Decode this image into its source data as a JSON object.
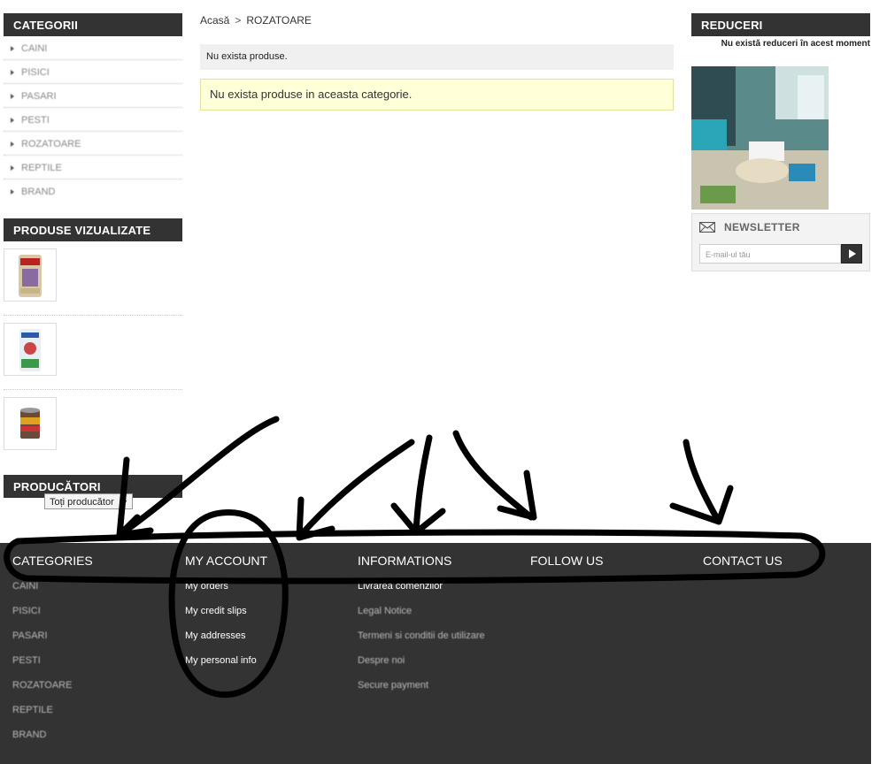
{
  "left": {
    "categories_title": "CATEGORII",
    "categories": [
      "CAINI",
      "PISICI",
      "PASARI",
      "PESTI",
      "ROZATOARE",
      "REPTILE",
      "BRAND"
    ],
    "viewed_title": "PRODUSE VIZUALIZATE",
    "producers_title": "PRODUCĂTORI",
    "producers_select": "Toți producător"
  },
  "breadcrumb": {
    "home": "Acasă",
    "separator": ">",
    "current": "ROZATOARE"
  },
  "center": {
    "notice_grey": "Nu exista produse.",
    "notice_yellow": "Nu exista produse in aceasta categorie."
  },
  "right": {
    "discounts_title": "REDUCERI",
    "discounts_message": "Nu există reduceri în acest moment",
    "newsletter_title": "NEWSLETTER",
    "newsletter_placeholder": "E-mail-ul tău"
  },
  "footer": {
    "categories": {
      "title": "CATEGORIES",
      "items": [
        "CAINI",
        "PISICI",
        "PASARI",
        "PESTI",
        "ROZATOARE",
        "REPTILE",
        "BRAND"
      ]
    },
    "my_account": {
      "title": "MY ACCOUNT",
      "items": [
        "My orders",
        "My credit slips",
        "My addresses",
        "My personal info"
      ]
    },
    "informations": {
      "title": "INFORMATIONS",
      "items": [
        "Livrarea comenzilor",
        "Legal Notice",
        "Termeni si conditii de utilizare",
        "Despre noi",
        "Secure payment"
      ]
    },
    "follow_us": {
      "title": "FOLLOW US"
    },
    "contact_us": {
      "title": "CONTACT US"
    }
  },
  "colors": {
    "dark": "#333333",
    "notice_yellow": "#ffffd8",
    "notice_grey": "#f0f0f0",
    "annotation": "#000000"
  }
}
